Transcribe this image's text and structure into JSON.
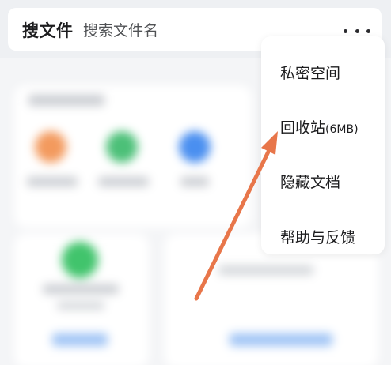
{
  "search": {
    "title": "搜文件",
    "placeholder": "搜索文件名"
  },
  "menu": {
    "items": [
      {
        "label": "私密空间",
        "extra": ""
      },
      {
        "label": "回收站",
        "extra": "(6MB)"
      },
      {
        "label": "隐藏文档",
        "extra": ""
      },
      {
        "label": "帮助与反馈",
        "extra": ""
      }
    ]
  },
  "icons": {
    "more": "more-dots-icon"
  },
  "colors": {
    "arrow": "#e8764a",
    "background": "#f4f5f7",
    "menu_bg": "#ffffff"
  }
}
